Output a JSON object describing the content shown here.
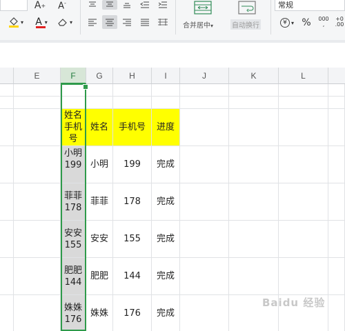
{
  "ribbon": {
    "merge_label": "合并居中",
    "wrap_label": "自动换行",
    "number_format": "常规",
    "font_color_letter": "A",
    "font_size_letter": "A",
    "percent_symbol": "%",
    "thousands_symbol": "000",
    "decimal_symbol": "+0",
    "currency_symbol": "¥"
  },
  "grid": {
    "columns": [
      "E",
      "F",
      "G",
      "H",
      "I",
      "J",
      "K",
      "L"
    ],
    "selected_column": "F",
    "headers": {
      "F": "姓名\n手机\n号",
      "G": "姓名",
      "H": "手机号",
      "I": "进度"
    },
    "rows": [
      {
        "F": "小明\n199",
        "G": "小明",
        "H": "199",
        "I": "完成"
      },
      {
        "F": "菲菲\n178",
        "G": "菲菲",
        "H": "178",
        "I": "完成"
      },
      {
        "F": "安安\n155",
        "G": "安安",
        "H": "155",
        "I": "完成"
      },
      {
        "F": "肥肥\n144",
        "G": "肥肥",
        "H": "144",
        "I": "完成"
      },
      {
        "F": "姝姝\n176",
        "G": "姝姝",
        "H": "176",
        "I": "完成"
      }
    ]
  },
  "watermark": "Baidu 经验",
  "colors": {
    "selection": "#2e9a4a",
    "header_highlight": "#ffff00",
    "font_color_bar": "#e02020",
    "fill_color_bar": "#ffd400"
  }
}
